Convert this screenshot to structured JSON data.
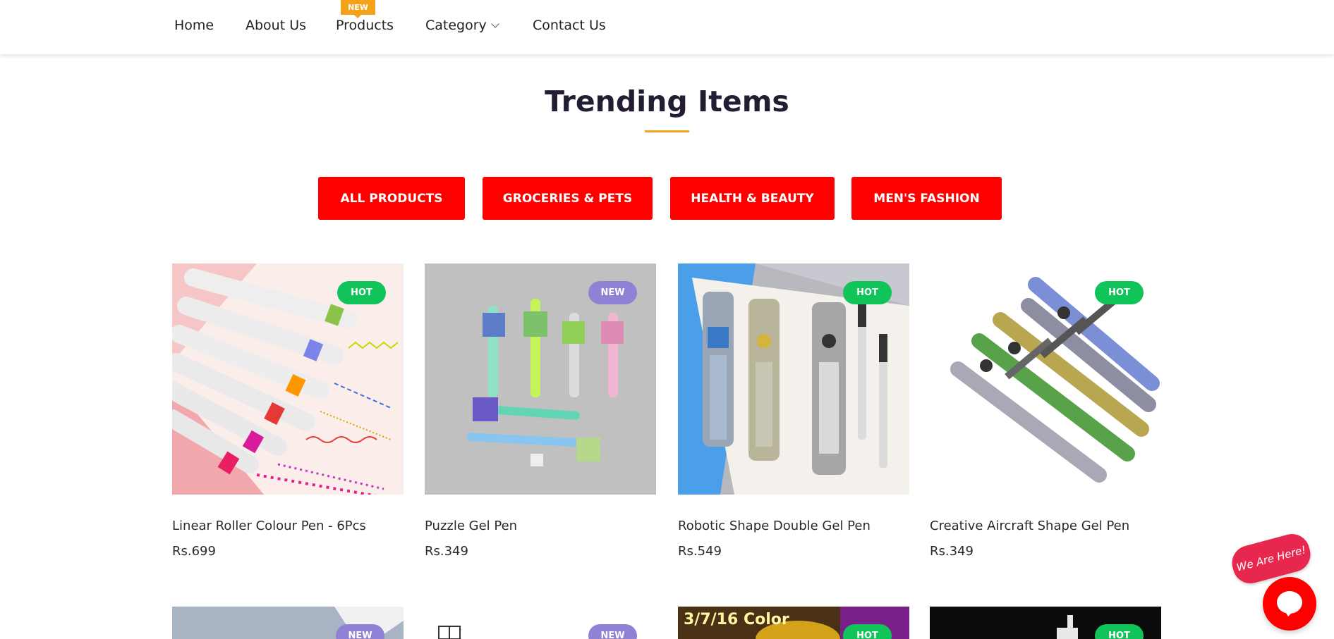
{
  "nav": {
    "items": [
      {
        "label": "Home"
      },
      {
        "label": "About Us"
      },
      {
        "label": "Products",
        "badge": "NEW"
      },
      {
        "label": "Category"
      },
      {
        "label": "Contact Us"
      }
    ]
  },
  "section": {
    "title": "Trending Items"
  },
  "filters": [
    "ALL PRODUCTS",
    "GROCERIES & PETS",
    "HEALTH & BEAUTY",
    "MEN'S FASHION"
  ],
  "products": [
    {
      "badge": "HOT",
      "name": "Linear Roller Colour Pen - 6Pcs",
      "price": "Rs.699"
    },
    {
      "badge": "NEW",
      "name": "Puzzle Gel Pen",
      "price": "Rs.349"
    },
    {
      "badge": "HOT",
      "name": "Robotic Shape Double Gel Pen",
      "price": "Rs.549"
    },
    {
      "badge": "HOT",
      "name": "Creative Aircraft Shape Gel Pen",
      "price": "Rs.349"
    }
  ],
  "products_row2": [
    {
      "badge": "NEW"
    },
    {
      "badge": "NEW"
    },
    {
      "badge": "HOT",
      "overlay_text": "3/7/16 Color"
    },
    {
      "badge": "HOT"
    }
  ],
  "chat": {
    "tag": "We Are Here!"
  },
  "colors": {
    "accent": "#ff0000",
    "brand_orange": "#f5a21b",
    "badge_hot": "#11c45a",
    "badge_new": "#9081d6"
  },
  "icons": [
    "chevron-down-icon",
    "chat-icon"
  ]
}
